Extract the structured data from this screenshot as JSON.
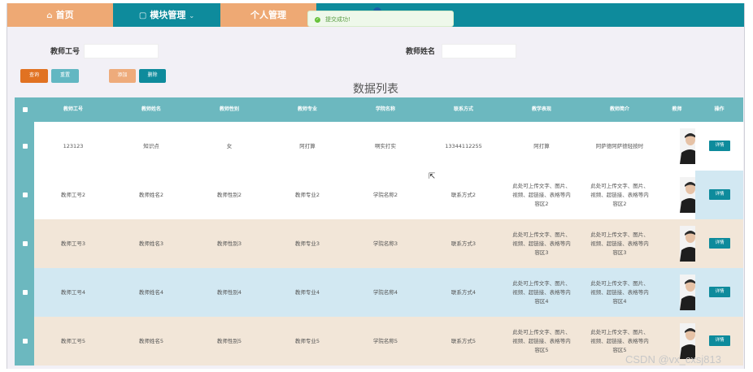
{
  "nav": {
    "home": "首页",
    "module": "模块管理",
    "personal": "个人管理"
  },
  "toast": "提交成功!",
  "search": {
    "label_id": "教师工号",
    "label_name": "教师姓名",
    "value_id": "",
    "value_name": ""
  },
  "buttons": {
    "query": "查询",
    "reset": "重置",
    "add": "添加",
    "delete": "删除"
  },
  "list_title": "数据列表",
  "columns": [
    "教师工号",
    "教师姓名",
    "教师性别",
    "教师专业",
    "学院名称",
    "联系方式",
    "教学表现",
    "教师简介",
    "教师",
    "操作"
  ],
  "rows": [
    {
      "id": "123123",
      "name": "知识点",
      "gender": "女",
      "major": "阿打算",
      "college": "啊实打实",
      "contact": "13344112255",
      "perf": "阿打算",
      "intro": "阿萨德阿萨德轻按时",
      "bg": "#ffffff",
      "action": "详情"
    },
    {
      "id": "教师工号2",
      "name": "教师姓名2",
      "gender": "教师性别2",
      "major": "教师专业2",
      "college": "学院名称2",
      "contact": "联系方式2",
      "perf": "此处可上传文字、图片、视频、超链接、表格等内容区2",
      "intro": "此处可上传文字、图片、视频、超链接、表格等内容区2",
      "bg": "#ffffff",
      "action": "详情"
    },
    {
      "id": "教师工号3",
      "name": "教师姓名3",
      "gender": "教师性别3",
      "major": "教师专业3",
      "college": "学院名称3",
      "contact": "联系方式3",
      "perf": "此处可上传文字、图片、视频、超链接、表格等内容区3",
      "intro": "此处可上传文字、图片、视频、超链接、表格等内容区3",
      "bg": "#f2e6d8",
      "action": "详情"
    },
    {
      "id": "教师工号4",
      "name": "教师姓名4",
      "gender": "教师性别4",
      "major": "教师专业4",
      "college": "学院名称4",
      "contact": "联系方式4",
      "perf": "此处可上传文字、图片、视频、超链接、表格等内容区4",
      "intro": "此处可上传文字、图片、视频、超链接、表格等内容区4",
      "bg": "#d2e8f2",
      "action": "详情"
    },
    {
      "id": "教师工号5",
      "name": "教师姓名5",
      "gender": "教师性别5",
      "major": "教师专业5",
      "college": "学院名称5",
      "contact": "联系方式5",
      "perf": "此处可上传文字、图片、视频、超链接、表格等内容区5",
      "intro": "此处可上传文字、图片、视频、超链接、表格等内容区5",
      "bg": "#f2e6d8",
      "action": "详情"
    }
  ],
  "watermark": "CSDN @vx_cxsj813",
  "colors": {
    "teal": "#0e8b9c",
    "orange": "#eea974",
    "header": "#6cb8bf"
  }
}
